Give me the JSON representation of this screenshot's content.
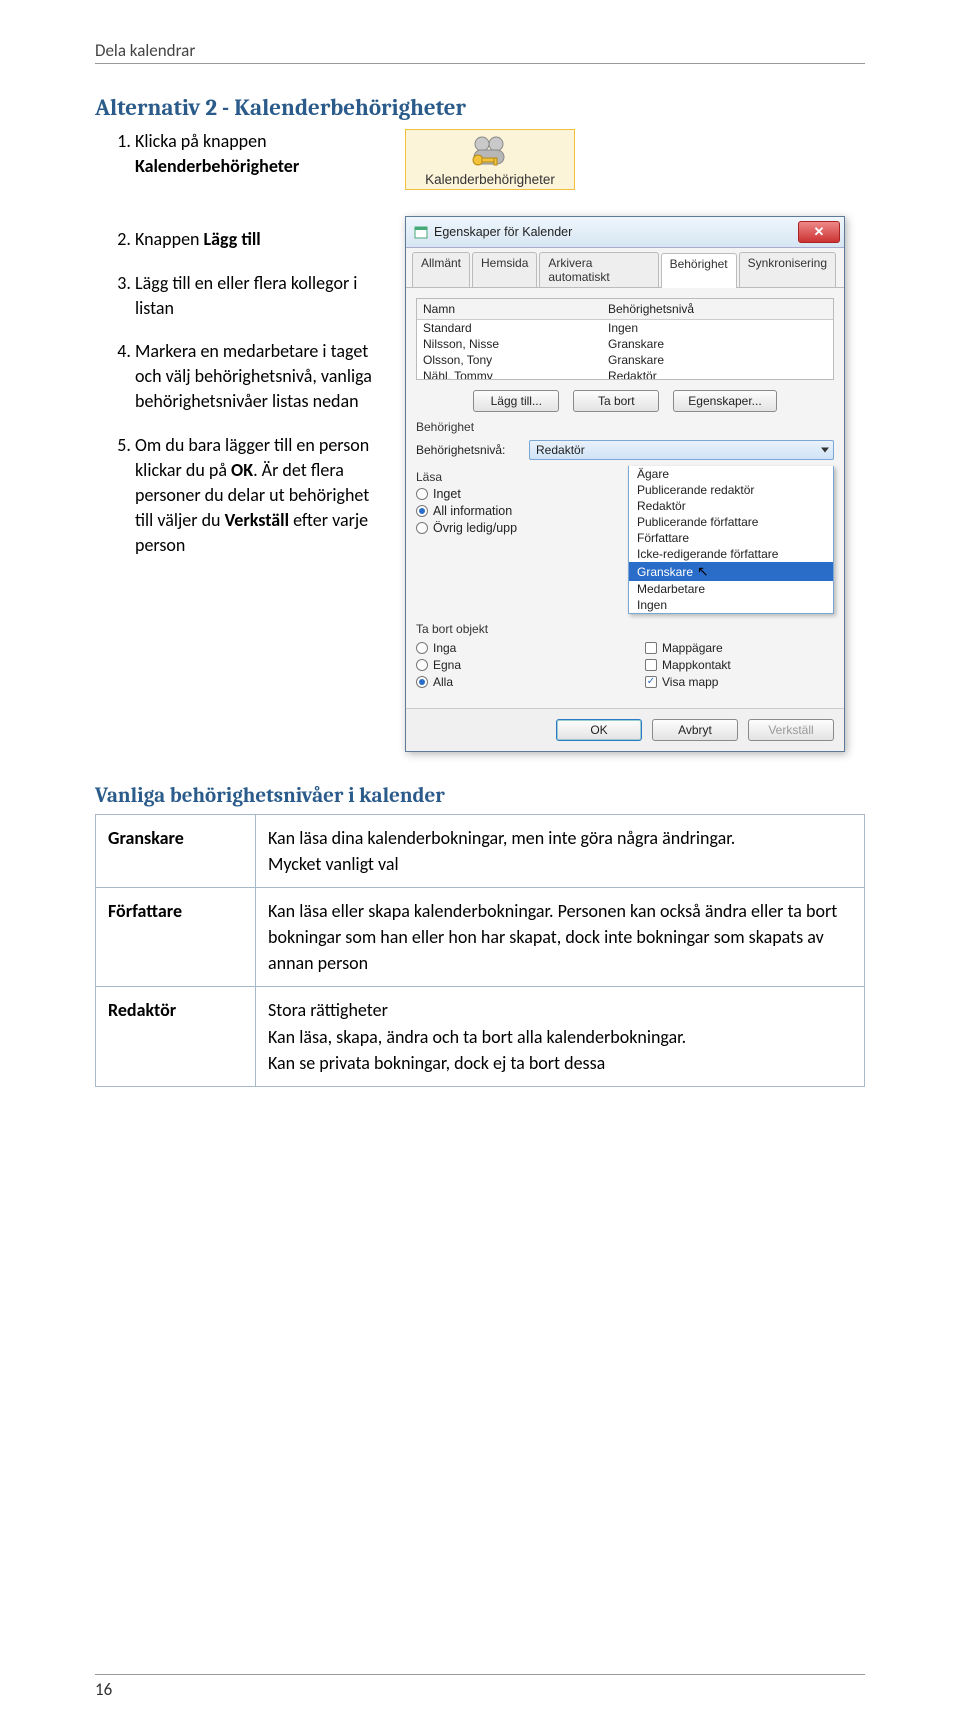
{
  "header": "Dela kalendrar",
  "section_heading": "Alternativ 2 - Kalenderbehörigheter",
  "steps": {
    "s1": {
      "pre": "Klicka på knappen ",
      "bold": "Kalenderbehörigheter"
    },
    "s2": {
      "pre": "Knappen ",
      "bold": "Lägg till"
    },
    "s3": "Lägg till en eller flera kollegor i listan",
    "s4": "Markera en medarbetare i taget och välj behörighetsnivå, vanliga behörighetsnivåer listas nedan",
    "s5a": "Om du bara lägger till en person klickar du på ",
    "s5b": "OK",
    "s5c": ". Är det flera personer du delar ut behörighet till väljer du ",
    "s5d": "Verkställ",
    "s5e": " efter varje person"
  },
  "calbtn_label": "Kalenderbehörigheter",
  "dialog": {
    "title": "Egenskaper för Kalender",
    "tabs": [
      "Allmänt",
      "Hemsida",
      "Arkivera automatiskt",
      "Behörighet",
      "Synkronisering"
    ],
    "col_name": "Namn",
    "col_level": "Behörighetsnivå",
    "rows": [
      {
        "name": "Standard",
        "level": "Ingen"
      },
      {
        "name": "Nilsson, Nisse",
        "level": "Granskare"
      },
      {
        "name": "Olsson, Tony",
        "level": "Granskare"
      },
      {
        "name": "Nähl, Tommy",
        "level": "Redaktör"
      }
    ],
    "btn_add": "Lägg till...",
    "btn_remove": "Ta bort",
    "btn_props": "Egenskaper...",
    "group_perm": "Behörighet",
    "level_label": "Behörighetsnivå:",
    "level_value": "Redaktör",
    "dd_options": [
      "Ägare",
      "Publicerande redaktör",
      "Redaktör",
      "Publicerande författare",
      "Författare",
      "Icke-redigerande författare",
      "Granskare",
      "Medarbetare",
      "Ingen"
    ],
    "read_label": "Läsa",
    "read_inget": "Inget",
    "read_all": "All information",
    "read_ovrig": "Övrig ledig/upp",
    "delete_label": "Ta bort objekt",
    "del_inga": "Inga",
    "del_egna": "Egna",
    "del_alla": "Alla",
    "chk_mappagare": "Mappägare",
    "chk_mappkontakt": "Mappkontakt",
    "chk_visa": "Visa mapp",
    "btn_ok": "OK",
    "btn_cancel": "Avbryt",
    "btn_apply": "Verkställ"
  },
  "levels_heading": "Vanliga behörighetsnivåer i kalender",
  "roles": {
    "granskare": {
      "name": "Granskare",
      "l1": "Kan läsa dina kalenderbokningar, men inte göra några ändringar.",
      "l2": "Mycket vanligt val"
    },
    "forfattare": {
      "name": "Författare",
      "desc": "Kan läsa eller skapa kalenderbokningar. Personen kan också ändra eller ta bort bokningar som han eller hon har skapat, dock inte bokningar som skapats av annan person"
    },
    "redaktor": {
      "name": "Redaktör",
      "l1": "Stora rättigheter",
      "l2": "Kan läsa, skapa, ändra och ta bort alla kalenderbokningar.",
      "l3": "Kan se privata bokningar, dock ej ta bort dessa"
    }
  },
  "page_number": "16"
}
